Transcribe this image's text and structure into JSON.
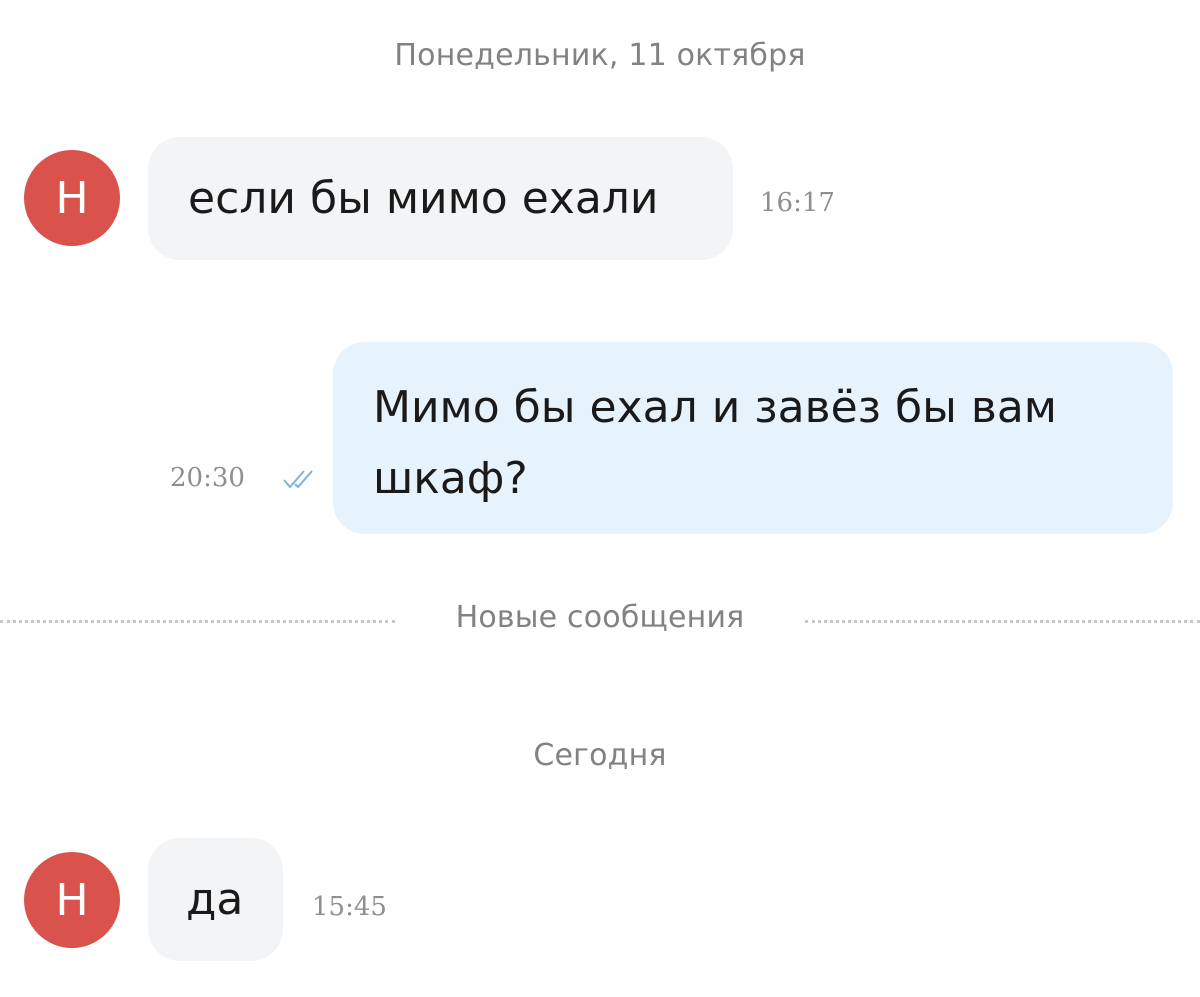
{
  "chat": {
    "date_1": "Понедельник, 11 октября",
    "msg_1": {
      "sender_initial": "Н",
      "text": "если бы мимо ехали",
      "time": "16:17"
    },
    "msg_2": {
      "line_1": "Мимо бы ехал и завёз бы вам",
      "line_2": "шкаф?",
      "time": "20:30",
      "status_icon": "double-check-icon"
    },
    "new_messages_label": "Новые сообщения",
    "date_2": "Сегодня",
    "msg_3": {
      "sender_initial": "Н",
      "text": "да",
      "time": "15:45"
    }
  },
  "colors": {
    "avatar": "#d9534c",
    "incoming_bubble": "#f3f4f6",
    "outgoing_bubble": "#e6f2fc",
    "read_ticks": "#7ab4e0"
  }
}
